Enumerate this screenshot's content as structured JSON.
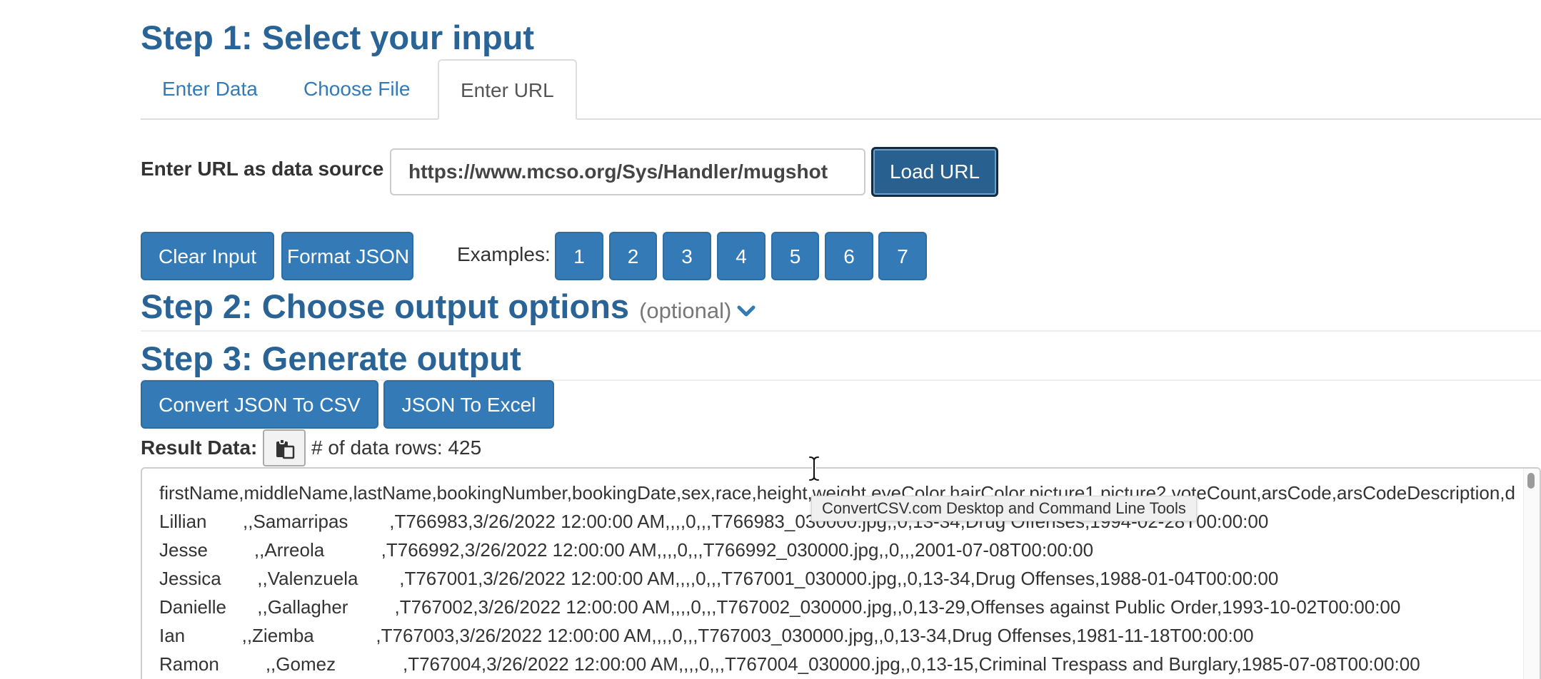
{
  "step1": {
    "title": "Step 1: Select your input",
    "tabs": [
      {
        "label": "Enter Data",
        "active": false
      },
      {
        "label": "Choose File",
        "active": false
      },
      {
        "label": "Enter URL",
        "active": true
      }
    ],
    "url_label": "Enter URL as data source",
    "url_value": "https://www.mcso.org/Sys/Handler/mugshot",
    "load_button": "Load URL",
    "clear_button": "Clear Input",
    "format_button": "Format JSON",
    "examples_label": "Examples:",
    "examples": [
      "1",
      "2",
      "3",
      "4",
      "5",
      "6",
      "7"
    ]
  },
  "step2": {
    "title": "Step 2: Choose output options",
    "optional": "(optional)",
    "expand_icon": "chevron-down-icon"
  },
  "step3": {
    "title": "Step 3: Generate output",
    "convert_csv_button": "Convert JSON To CSV",
    "excel_button": "JSON To Excel",
    "result_label": "Result Data:",
    "copy_icon": "clipboard-icon",
    "rows_count": "# of data rows: 425",
    "lines": [
      "firstName,middleName,lastName,bookingNumber,bookingDate,sex,race,height,weight,eyeColor,hairColor,picture1,picture2,voteCount,arsCode,arsCodeDescription,dob",
      "Lillian       ,,Samarripas        ,T766983,3/26/2022 12:00:00 AM,,,,0,,,T766983_030000.jpg,,0,13-34,Drug Offenses,1994-02-28T00:00:00",
      "Jesse         ,,Arreola           ,T766992,3/26/2022 12:00:00 AM,,,,0,,,T766992_030000.jpg,,0,,,2001-07-08T00:00:00",
      "Jessica       ,,Valenzuela        ,T767001,3/26/2022 12:00:00 AM,,,,0,,,T767001_030000.jpg,,0,13-34,Drug Offenses,1988-01-04T00:00:00",
      "Danielle      ,,Gallagher         ,T767002,3/26/2022 12:00:00 AM,,,,0,,,T767002_030000.jpg,,0,13-29,Offenses against Public Order,1993-10-02T00:00:00",
      "Ian           ,,Ziemba            ,T767003,3/26/2022 12:00:00 AM,,,,0,,,T767003_030000.jpg,,0,13-34,Drug Offenses,1981-11-18T00:00:00",
      "Ramon         ,,Gomez             ,T767004,3/26/2022 12:00:00 AM,,,,0,,,T767004_030000.jpg,,0,13-15,Criminal Trespass and Burglary,1985-07-08T00:00:00"
    ],
    "tooltip": "ConvertCSV.com Desktop and Command Line Tools"
  },
  "colors": {
    "heading": "#2a6496",
    "link": "#337ab7",
    "button": "#337ab7",
    "button_active": "#286090"
  }
}
